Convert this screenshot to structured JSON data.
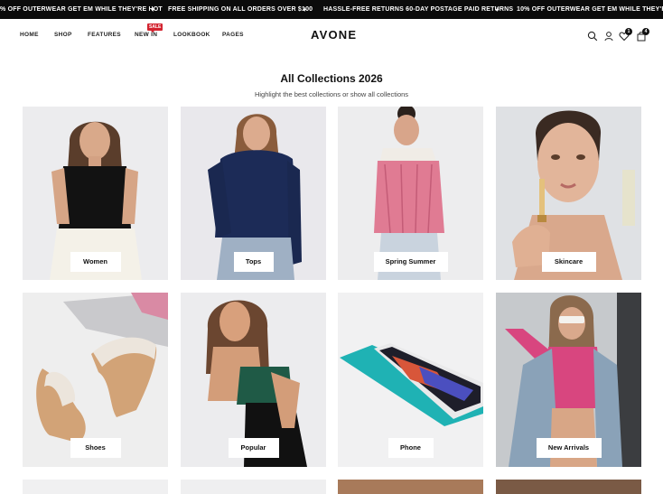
{
  "announcements": [
    "% OFF OUTERWEAR GET EM WHILE THEY'RE HOT",
    "FREE SHIPPING ON ALL ORDERS OVER $100",
    "HASSLE-FREE RETURNS 60-DAY POSTAGE PAID RETURNS",
    "10% OFF OUTERWEAR GET EM WHILE THEY'RE HOT"
  ],
  "announcement_separator": "+",
  "nav": [
    "HOME",
    "SHOP",
    "FEATURES",
    "NEW IN",
    "LOOKBOOK",
    "PAGES"
  ],
  "sale_badge": "SALE",
  "brand": "AVONE",
  "header_icons": [
    "search-icon",
    "user-icon",
    "heart-icon",
    "bag-icon"
  ],
  "wishlist_count": "1",
  "cart_count": "4",
  "section": {
    "title": "All Collections 2026",
    "subtitle": "Highlight the best collections or show all collections"
  },
  "collections": [
    "Women",
    "Tops",
    "Spring Summer",
    "Skincare",
    "Shoes",
    "Popular",
    "Phone",
    "New Arrivals"
  ],
  "colors": {
    "topbar": "#0b0b0b",
    "sale": "#d3232f",
    "card_bg": "#eeeef0"
  }
}
